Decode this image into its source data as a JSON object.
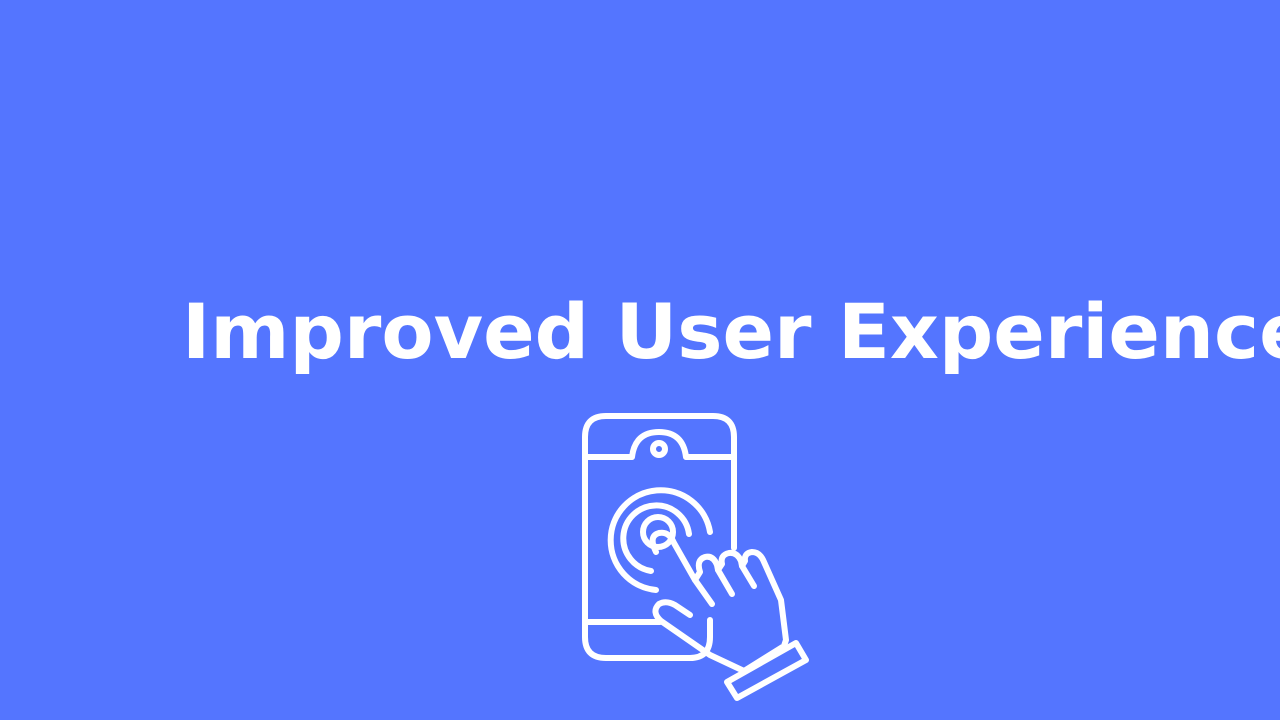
{
  "slide": {
    "title": "Improved User Experience",
    "icon": "touchscreen-tap-icon",
    "colors": {
      "background": "#5475FF",
      "foreground": "#FFFFFF"
    }
  }
}
